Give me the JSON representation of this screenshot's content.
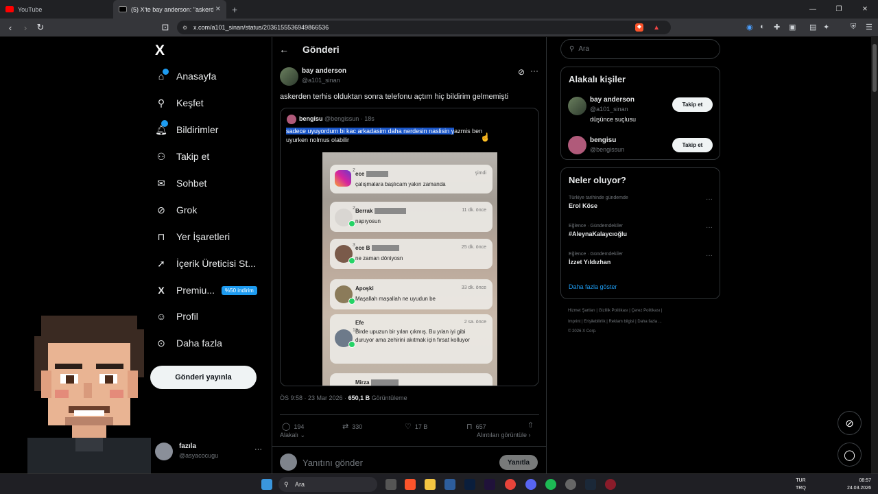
{
  "browser": {
    "tabs": [
      {
        "label": "YouTube"
      },
      {
        "label": "(5) X'te bay anderson: \"askerden"
      }
    ],
    "new_tab": "+",
    "url": "x.com/a101_sinan/status/2036155536949866536"
  },
  "sidebar": {
    "logo": "X",
    "items": [
      {
        "label": "Anasayfa",
        "icon": "home-icon"
      },
      {
        "label": "Keşfet",
        "icon": "search-icon"
      },
      {
        "label": "Bildirimler",
        "icon": "bell-icon"
      },
      {
        "label": "Takip et",
        "icon": "person-add-icon"
      },
      {
        "label": "Sohbet",
        "icon": "mail-icon"
      },
      {
        "label": "Grok",
        "icon": "grok-icon"
      },
      {
        "label": "Yer İşaretleri",
        "icon": "bookmark-icon"
      },
      {
        "label": "İçerik Üreticisi St...",
        "icon": "rocket-icon"
      },
      {
        "label": "Premiu...",
        "icon": "x-icon"
      },
      {
        "label": "Profil",
        "icon": "person-icon"
      },
      {
        "label": "Daha fazla",
        "icon": "more-circle-icon"
      }
    ],
    "premium_badge": "%50 indirim",
    "post_button": "Gönderi yayınla",
    "account": {
      "name": "fazıla",
      "handle": "@asyacocugu",
      "more": "···"
    }
  },
  "post": {
    "header_title": "Gönderi",
    "author_name": "bay anderson",
    "author_handle": "@a101_sinan",
    "text": "askerden terhis olduktan sonra telefonu açtım hiç bildirim gelmemişti",
    "quote": {
      "author_name": "bengisu",
      "author_handle": "@bengissun · 18s",
      "text_highlighted": "sadece uyuyordum bi kac arkadasim daha nerdesin naslisin y",
      "text_rest": "azmis ben",
      "text_line2": "uyurken nolmus olabilir",
      "notifications": [
        {
          "title": "ece",
          "time": "şimdi",
          "text": "çalışmalara başlıcam yakın zamanda",
          "count": "2"
        },
        {
          "title": "Berrak",
          "time": "11 dk. önce",
          "text": "napıyosun",
          "count": "2"
        },
        {
          "title": "ece B",
          "time": "25 dk. önce",
          "text": "ne zaman döniyosn",
          "count": "3"
        },
        {
          "title": "Apoşki",
          "time": "33 dk. önce",
          "text": "Maşallah maşallah ne uyudun be",
          "count": ""
        },
        {
          "title": "Efe",
          "time": "2 sa. önce",
          "text": "Birde upuzun bir yılan çıkmış. Bu yılan iyi gibi duruyor ama zehirini akıtmak için fırsat kolluyor",
          "count": "13"
        },
        {
          "title": "Mirza",
          "time": "",
          "text": "",
          "count": ""
        }
      ]
    },
    "meta_time": "ÖS 9:58 · 23 Mar 2026 · ",
    "meta_views": "650,1 B",
    "meta_views_label": " Görüntüleme",
    "actions": {
      "replies": "194",
      "reposts": "330",
      "likes": "17 B",
      "bookmarks": "657"
    },
    "related_label": "Alakalı",
    "quotes_label": "Alıntıları görüntüle",
    "reply_placeholder": "Yanıtını gönder",
    "reply_button": "Yanıtla"
  },
  "right": {
    "search_placeholder": "Ara",
    "relevant_title": "Alakalı kişiler",
    "people": [
      {
        "name": "bay anderson",
        "handle": "@a101_sinan",
        "bio": "düşünce suçlusu",
        "button": "Takip et"
      },
      {
        "name": "bengisu",
        "handle": "@bengissun",
        "bio": "",
        "button": "Takip et"
      }
    ],
    "trending_title": "Neler oluyor?",
    "trends": [
      {
        "context": "Türkiye tarihinde gündemde",
        "name": "Erol Köse"
      },
      {
        "context": "Eğlence · Gündemdekiler",
        "name": "#AleynaKalaycıoğlu"
      },
      {
        "context": "Eğlence · Gündemdekiler",
        "name": "İzzet Yıldızhan"
      }
    ],
    "show_more": "Daha fazla göster",
    "footer_line1": "Hizmet Şartları  |  Gizlilik Politikası  |  Çerez Politikası  |",
    "footer_line2": "Imprint  |  Erişilebilirlik  |  Reklam bilgisi  |  Daha fazla ...",
    "footer_line3": "© 2026 X Corp."
  },
  "taskbar": {
    "search_placeholder": "Ara",
    "lang_top": "TUR",
    "lang_bottom": "TRQ",
    "time": "08:57",
    "date": "24.03.2026"
  },
  "colors": {
    "accent": "#1d9bf0",
    "background": "#000000",
    "text": "#e7e9ea",
    "muted": "#71767b"
  }
}
